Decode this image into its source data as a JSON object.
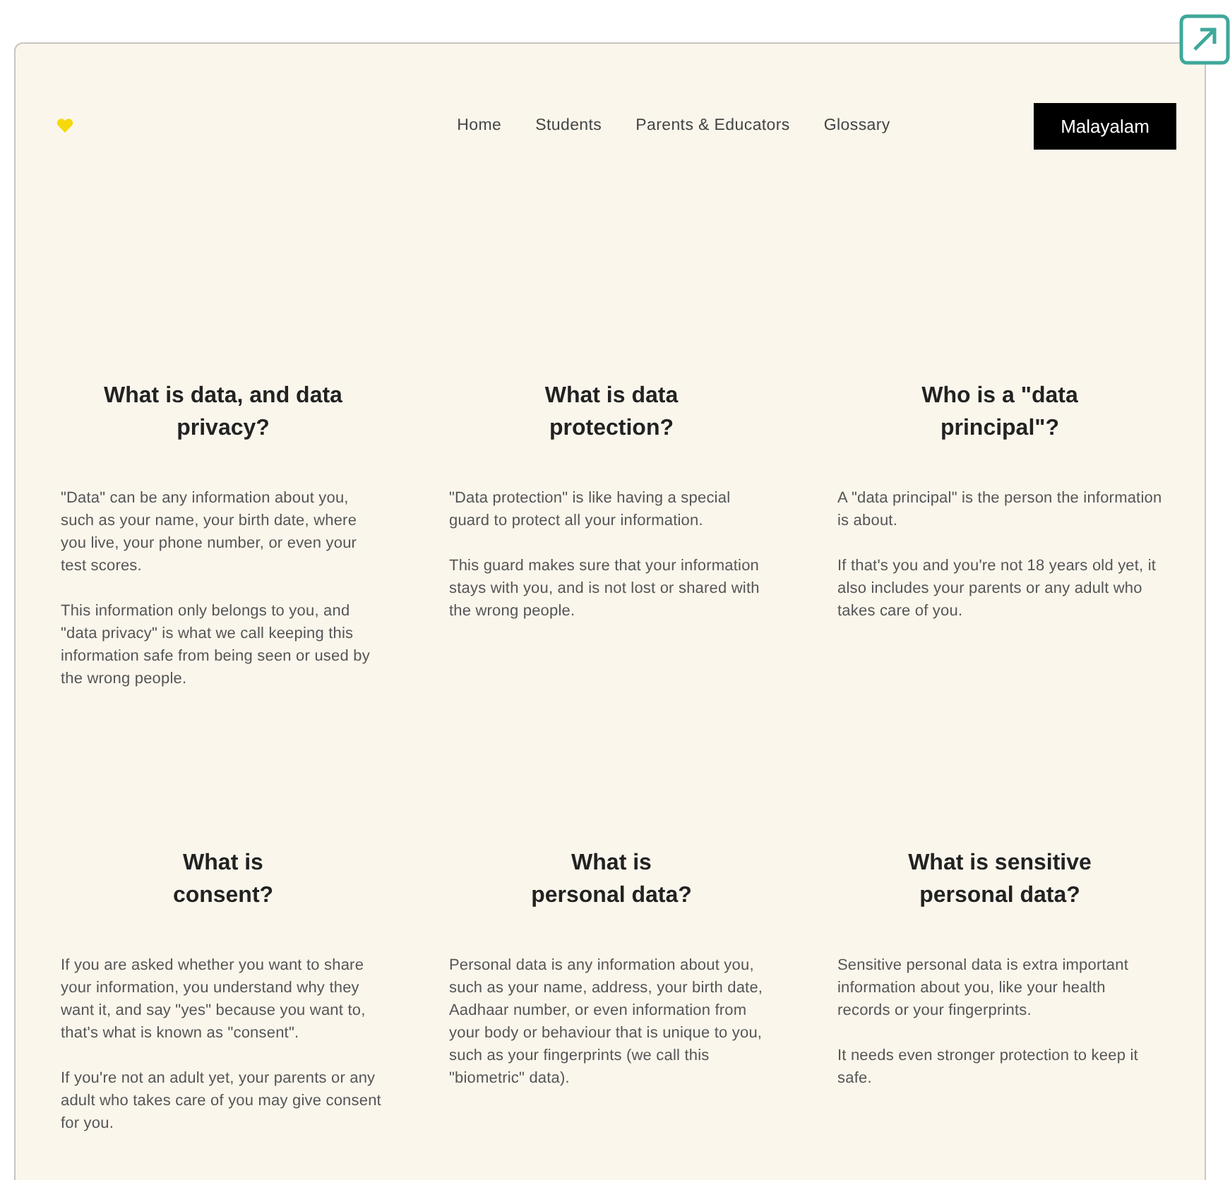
{
  "nav": {
    "links": [
      {
        "label": "Home"
      },
      {
        "label": "Students"
      },
      {
        "label": "Parents & Educators"
      },
      {
        "label": "Glossary"
      }
    ],
    "language_button": "Malayalam"
  },
  "sections": [
    {
      "heading": "What is data, and data\nprivacy?",
      "paragraphs": [
        "\"Data\" can be any information about you, such as your name, your birth date, where you live, your phone number, or even your test scores.",
        "This information only belongs to you, and \"data privacy\" is what we call keeping this information safe from being seen or used by the wrong people."
      ]
    },
    {
      "heading": "What is data\nprotection?",
      "paragraphs": [
        "\"Data protection\" is like having a special guard to protect all your information.",
        "This guard makes sure that your information stays with you, and is not lost or shared with the wrong people."
      ]
    },
    {
      "heading": "Who is a \"data\nprincipal\"?",
      "paragraphs": [
        "A \"data principal\" is the person the information is about.",
        "If that's you and you're not 18 years old yet, it also includes your parents or any adult who takes care of you."
      ]
    },
    {
      "heading": "What is\nconsent?",
      "paragraphs": [
        "If you are asked whether you want to share your information, you understand why they want it, and say \"yes\" because you want to, that's what is known as \"consent\".",
        "If you're not an adult yet, your parents or any adult who takes care of you may give consent for you."
      ]
    },
    {
      "heading": "What is\npersonal data?",
      "paragraphs": [
        "Personal data is any information about you, such as your name, address, your birth date, Aadhaar number, or even information from your body or behaviour that is unique to you, such as your fingerprints (we call this \"biometric\" data)."
      ]
    },
    {
      "heading": "What is sensitive\npersonal data?",
      "paragraphs": [
        "Sensitive personal data is extra important information about you, like your health records or your fingerprints.",
        "It needs even stronger protection to keep it safe."
      ]
    }
  ]
}
